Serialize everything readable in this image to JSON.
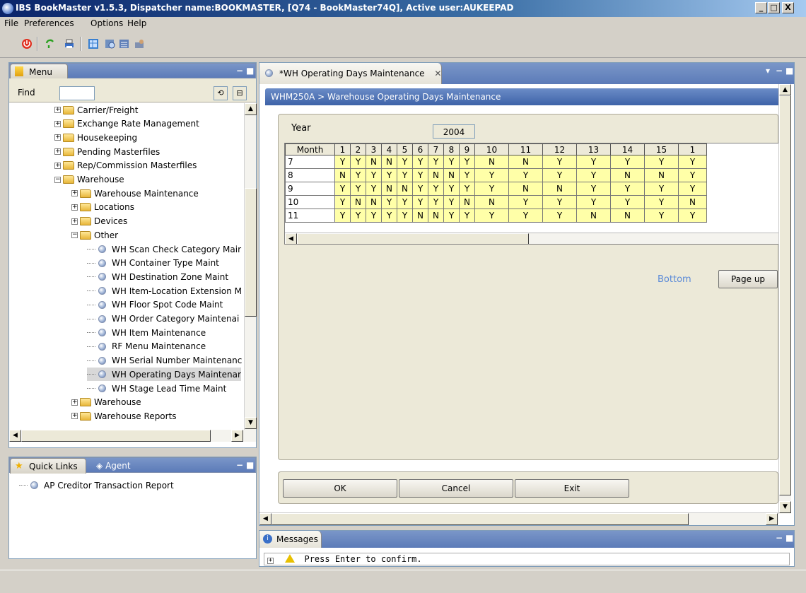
{
  "window": {
    "title": "IBS BookMaster v1.5.3, Dispatcher name:BOOKMASTER,  [Q74 - BookMaster74Q], Active user:AUKEEPAD",
    "minimize": "_",
    "maximize": "□",
    "close": "X"
  },
  "menubar": {
    "file": "File",
    "preferences": "Preferences",
    "options": "Options",
    "help": "Help"
  },
  "toolbar": {
    "icons": [
      "power-icon",
      "refresh-icon",
      "print-icon",
      "grid-icon",
      "report-icon",
      "export-icon",
      "user-icon"
    ]
  },
  "menu_panel": {
    "tab_label": "Menu",
    "find_label": "Find",
    "find_value": "",
    "tree": [
      {
        "label": "Carrier/Freight",
        "level": 0,
        "type": "folder",
        "expanded": false
      },
      {
        "label": "Exchange Rate Management",
        "level": 0,
        "type": "folder",
        "expanded": false
      },
      {
        "label": "Housekeeping",
        "level": 0,
        "type": "folder",
        "expanded": false
      },
      {
        "label": "Pending Masterfiles",
        "level": 0,
        "type": "folder",
        "expanded": false
      },
      {
        "label": "Rep/Commission Masterfiles",
        "level": 0,
        "type": "folder",
        "expanded": false
      },
      {
        "label": "Warehouse",
        "level": 0,
        "type": "folder",
        "expanded": true
      },
      {
        "label": "Warehouse Maintenance",
        "level": 1,
        "type": "folder",
        "expanded": false
      },
      {
        "label": "Locations",
        "level": 1,
        "type": "folder",
        "expanded": false
      },
      {
        "label": "Devices",
        "level": 1,
        "type": "folder",
        "expanded": false
      },
      {
        "label": "Other",
        "level": 1,
        "type": "folder",
        "expanded": true
      },
      {
        "label": "WH Scan Check Category Mair",
        "level": 2,
        "type": "leaf"
      },
      {
        "label": "WH Container Type Maint",
        "level": 2,
        "type": "leaf"
      },
      {
        "label": "WH Destination Zone Maint",
        "level": 2,
        "type": "leaf"
      },
      {
        "label": "WH Item-Location Extension M",
        "level": 2,
        "type": "leaf"
      },
      {
        "label": "WH Floor Spot Code Maint",
        "level": 2,
        "type": "leaf"
      },
      {
        "label": "WH Order Category Maintenai",
        "level": 2,
        "type": "leaf"
      },
      {
        "label": "WH Item Maintenance",
        "level": 2,
        "type": "leaf"
      },
      {
        "label": "RF Menu Maintenance",
        "level": 2,
        "type": "leaf"
      },
      {
        "label": "WH Serial Number Maintenanc",
        "level": 2,
        "type": "leaf"
      },
      {
        "label": "WH Operating Days Maintenar",
        "level": 2,
        "type": "leaf",
        "selected": true
      },
      {
        "label": "WH Stage Lead Time Maint",
        "level": 2,
        "type": "leaf"
      },
      {
        "label": "Warehouse",
        "level": 1,
        "type": "folder",
        "expanded": false
      },
      {
        "label": "Warehouse Reports",
        "level": 1,
        "type": "folder",
        "expanded": false
      }
    ]
  },
  "quick_panel": {
    "tab_quicklinks": "Quick Links",
    "tab_agent": "Agent",
    "items": [
      "AP Creditor Transaction Report"
    ]
  },
  "editor": {
    "tab_label": "*WH Operating Days Maintenance",
    "breadcrumb": "WHM250A > Warehouse Operating Days Maintenance",
    "year_label": "Year",
    "year_value": "2004",
    "grid": {
      "month_header": "Month",
      "day_headers": [
        "1",
        "2",
        "3",
        "4",
        "5",
        "6",
        "7",
        "8",
        "9",
        "10",
        "11",
        "12",
        "13",
        "14",
        "15",
        "1"
      ],
      "rows": [
        {
          "month": "7",
          "days": [
            "Y",
            "Y",
            "N",
            "N",
            "Y",
            "Y",
            "Y",
            "Y",
            "Y",
            "N",
            "N",
            "Y",
            "Y",
            "Y",
            "Y",
            "Y"
          ]
        },
        {
          "month": "8",
          "days": [
            "N",
            "Y",
            "Y",
            "Y",
            "Y",
            "Y",
            "N",
            "N",
            "Y",
            "Y",
            "Y",
            "Y",
            "Y",
            "N",
            "N",
            "Y"
          ]
        },
        {
          "month": "9",
          "days": [
            "Y",
            "Y",
            "Y",
            "N",
            "N",
            "Y",
            "Y",
            "Y",
            "Y",
            "Y",
            "N",
            "N",
            "Y",
            "Y",
            "Y",
            "Y"
          ]
        },
        {
          "month": "10",
          "days": [
            "Y",
            "N",
            "N",
            "Y",
            "Y",
            "Y",
            "Y",
            "Y",
            "N",
            "N",
            "Y",
            "Y",
            "Y",
            "Y",
            "Y",
            "N"
          ]
        },
        {
          "month": "11",
          "days": [
            "Y",
            "Y",
            "Y",
            "Y",
            "Y",
            "N",
            "N",
            "Y",
            "Y",
            "Y",
            "Y",
            "Y",
            "N",
            "N",
            "Y",
            "Y"
          ]
        }
      ]
    },
    "bottom_link": "Bottom",
    "page_up": "Page up",
    "ok": "OK",
    "cancel": "Cancel",
    "exit": "Exit"
  },
  "messages": {
    "tab_label": "Messages",
    "text": "Press Enter to confirm."
  },
  "colors": {
    "titlebar_start": "#0a246a",
    "panel_header": "#6b88c0",
    "grid_cell": "#ffffa8",
    "link": "#5a8ad8"
  }
}
